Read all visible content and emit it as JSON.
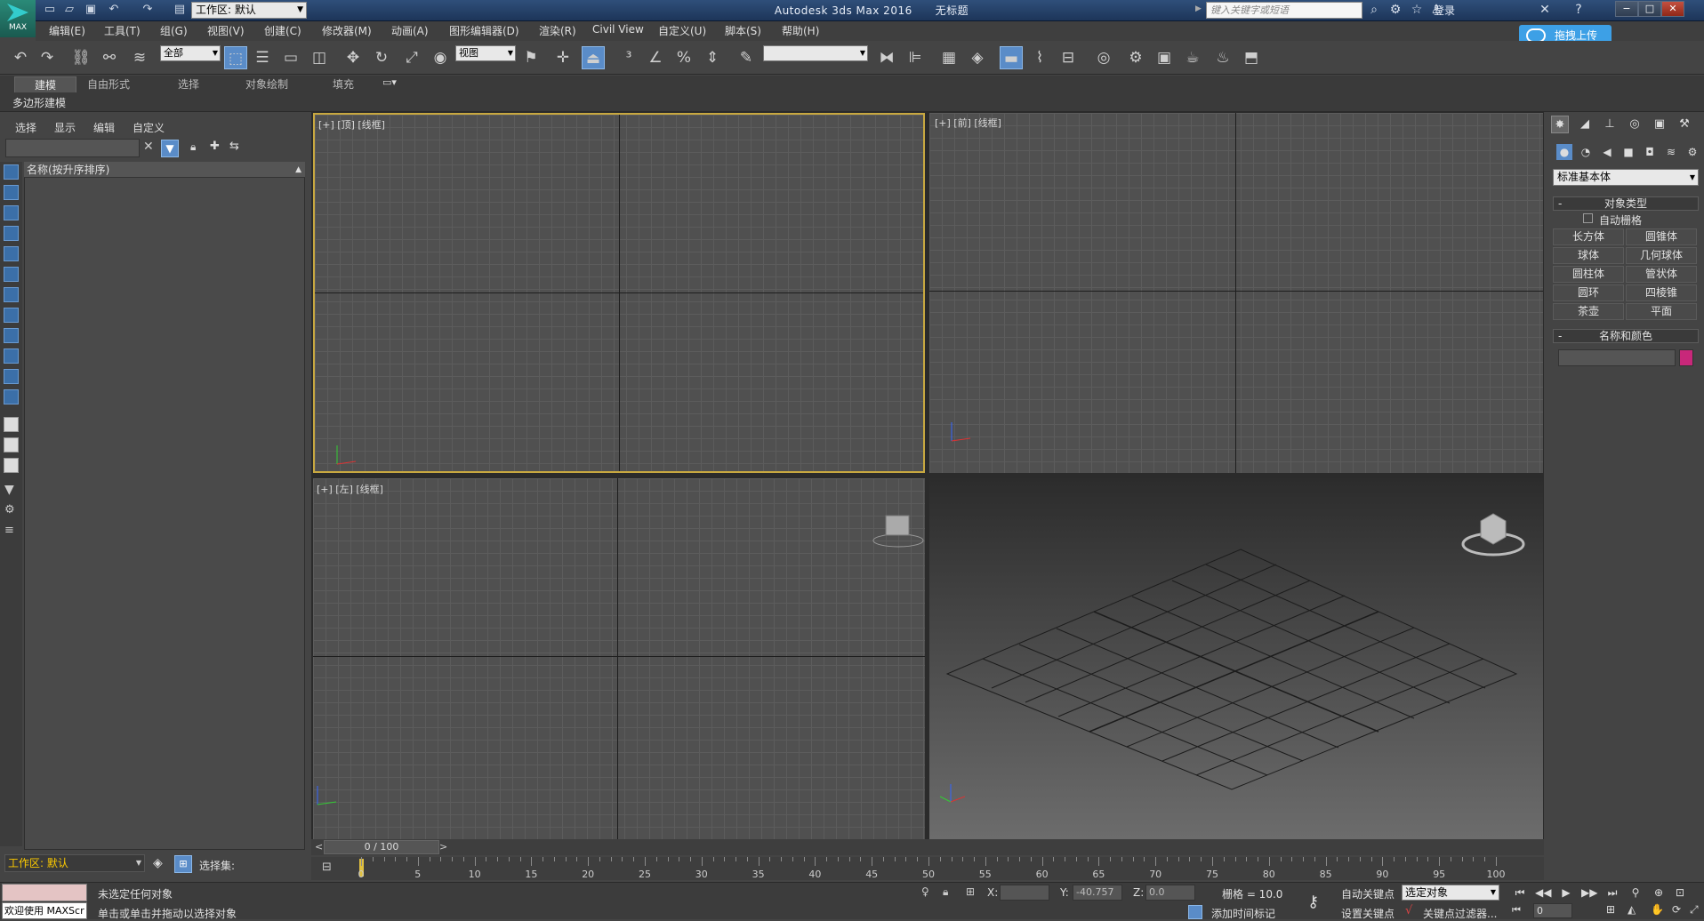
{
  "titlebar": {
    "workspace": "工作区: 默认",
    "app_title": "Autodesk 3ds Max 2016",
    "doc_title": "无标题",
    "search_placeholder": "键入关键字或短语",
    "login": "登录",
    "logo_text": "MAX"
  },
  "menu": {
    "items": [
      "编辑(E)",
      "工具(T)",
      "组(G)",
      "视图(V)",
      "创建(C)",
      "修改器(M)",
      "动画(A)",
      "图形编辑器(D)",
      "渲染(R)",
      "Civil View",
      "自定义(U)",
      "脚本(S)",
      "帮助(H)"
    ]
  },
  "upload_button": "拖拽上传",
  "toolbar": {
    "filter_dropdown": "全部",
    "refcoord_dropdown": "视图",
    "named_selection": ""
  },
  "ribbon": {
    "tabs": [
      "建模",
      "自由形式",
      "选择",
      "对象绘制",
      "填充"
    ],
    "subtab": "多边形建模"
  },
  "scene_explorer": {
    "tabs": [
      "选择",
      "显示",
      "编辑",
      "自定义"
    ],
    "column_header": "名称(按升序排序)",
    "workspace": "工作区: 默认",
    "selection_set_label": "选择集:"
  },
  "viewports": {
    "top": "[+] [顶] [线框]",
    "front": "[+] [前] [线框]",
    "left": "[+] [左] [线框]"
  },
  "command_panel": {
    "category": "标准基本体",
    "object_type_title": "对象类型",
    "autogrid_label": "自动栅格",
    "objects": [
      "长方体",
      "圆锥体",
      "球体",
      "几何球体",
      "圆柱体",
      "管状体",
      "圆环",
      "四棱锥",
      "茶壶",
      "平面"
    ],
    "name_color_title": "名称和颜色",
    "color": "#c8287a"
  },
  "timeline": {
    "slider_label": "0 / 100",
    "ticks": [
      "0",
      "5",
      "10",
      "15",
      "20",
      "25",
      "30",
      "35",
      "40",
      "45",
      "50",
      "55",
      "60",
      "65",
      "70",
      "75",
      "80",
      "85",
      "90",
      "95",
      "100"
    ]
  },
  "statusbar": {
    "maxscript": "欢迎使用 MAXScr",
    "status1": "未选定任何对象",
    "status2": "单击或单击并拖动以选择对象",
    "x_label": "X:",
    "x_value": "",
    "y_label": "Y:",
    "y_value": "-40.757",
    "z_label": "Z:",
    "z_value": "0.0",
    "grid": "栅格 = 10.0",
    "add_time_tag": "添加时间标记",
    "autokey": "自动关键点",
    "setkey": "设置关键点",
    "selection_dropdown": "选定对象",
    "key_filters": "关键点过滤器...",
    "frame": "0"
  }
}
